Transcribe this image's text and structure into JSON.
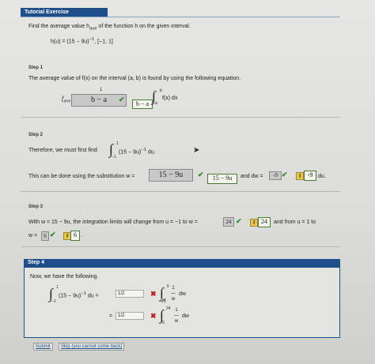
{
  "header": {
    "title": "Tutorial Exercise"
  },
  "problem": {
    "prompt": "Find the average value h",
    "prompt_sub": "ave",
    "prompt_rest": "of the function h on the given interval.",
    "function": "h(u) = (15 − 9u)",
    "exponent": "−1",
    "interval": ",   [−1, 1]"
  },
  "step1": {
    "label": "Step 1",
    "text": "The average value of f(x) on the interval (a, b) is found by using the following equation.",
    "f_ave": "f",
    "f_ave_sub": "ave",
    "equals": "=",
    "numerator": "1",
    "answer_box": "b − a",
    "green_answer": "b − a",
    "integrand": "f(x) dx",
    "upper": "b",
    "lower": "a"
  },
  "step2": {
    "label": "Step 2",
    "text1": "Therefore, we must first find",
    "integrand": "(15 − 9u)",
    "exponent": "−1",
    "du": "du.",
    "upper": "1",
    "lower": "−1",
    "text2": "This can be done using the substitution  w =",
    "w_box": "15 − 9u",
    "w_green": "15 − 9u",
    "dw_text": "and  dw =",
    "dw_box": "-9",
    "dw_green": "-9",
    "du2": "du."
  },
  "step3": {
    "label": "Step 3",
    "text": "With w = 15 − 9u, the integration limits will change from u = −1 to w =",
    "to_box": "24",
    "to_green": "24",
    "and_from": "and from u = 1 to",
    "w_eq": "w =",
    "from_box": "6",
    "from_green": "6",
    "dot": "."
  },
  "step4": {
    "label": "Step 4",
    "text": "Now, we have the following.",
    "integrand": "(15 − 9u)",
    "exponent": "−1",
    "du_eq": "du  =",
    "input1": "1/2",
    "input2": "1/2",
    "eq2": "=",
    "frac_top": "1",
    "frac_bot": "w",
    "dw": "dw",
    "i1_upper": "6",
    "i1_lower": "24",
    "i2_upper": "24",
    "i2_lower": "6",
    "outer_upper": "1",
    "outer_lower": "−1"
  },
  "footer": {
    "submit": "Submit",
    "skip": "Skip (you cannot come back)"
  },
  "colors": {
    "bar": "#1f4f8a",
    "check": "#2f8a2f",
    "cross": "#c02020",
    "key": "#e7c84a"
  }
}
